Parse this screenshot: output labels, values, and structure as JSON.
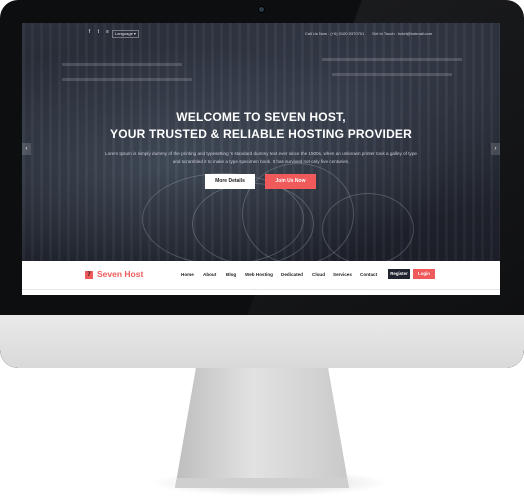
{
  "topbar": {
    "social_icons": [
      "facebook-icon",
      "twitter-icon",
      "rss-icon"
    ],
    "social_glyphs": [
      "f",
      "t",
      "≡"
    ],
    "language_label": "Language ▾",
    "phone": "Call Us Now : (+0) 0100 5370701",
    "email": "Get In Touch : hotel@hotmail.com"
  },
  "hero": {
    "title_line1": "WELCOME TO SEVEN HOST,",
    "title_line2": "YOUR TRUSTED & RELIABLE HOSTING PROVIDER",
    "text_line1": "Lorem Ipsum is simply dummy of the printing and typesetting 's standard dummy text ever since the 1500s, when an unknown printer took a galley of type",
    "text_line2": "and scrambled it to make a type specimen book. It has survived not only five centuries.",
    "btn_more": "More Details",
    "btn_join": "Join Us Now",
    "prev_arrow": "‹",
    "next_arrow": "›"
  },
  "nav": {
    "logo_mark": "7",
    "logo_text": "Seven Host",
    "items": [
      "Home",
      "About",
      "Blog",
      "Web Hosting",
      "Dedicated",
      "Cloud",
      "Services",
      "Contact"
    ],
    "register": "Register",
    "login": "Login"
  },
  "colors": {
    "accent": "#f05a5a",
    "dark": "#1f2430"
  }
}
